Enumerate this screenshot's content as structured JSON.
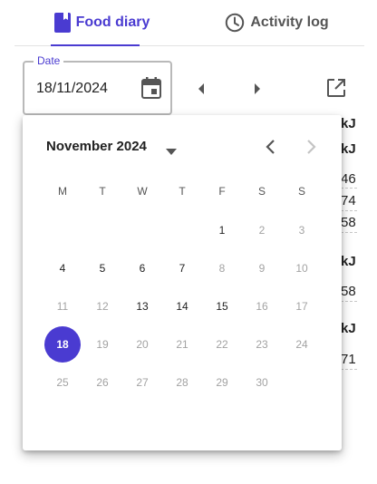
{
  "tabs": {
    "food_diary": "Food diary",
    "activity_log": "Activity log"
  },
  "date_field": {
    "label": "Date",
    "value": "18/11/2024"
  },
  "background_peek": [
    "kJ",
    "kJ",
    "46",
    "74",
    "58",
    "kJ",
    "58",
    "kJ",
    "71"
  ],
  "calendar": {
    "month_label": "November 2024",
    "weekdays": [
      "M",
      "T",
      "W",
      "T",
      "F",
      "S",
      "S"
    ],
    "weeks": [
      [
        null,
        null,
        null,
        null,
        "1",
        "2",
        "3"
      ],
      [
        "4",
        "5",
        "6",
        "7",
        "8",
        "9",
        "10"
      ],
      [
        "11",
        "12",
        "13",
        "14",
        "15",
        "16",
        "17"
      ],
      [
        "18",
        "19",
        "20",
        "21",
        "22",
        "23",
        "24"
      ],
      [
        "25",
        "26",
        "27",
        "28",
        "29",
        "30",
        null
      ]
    ],
    "enabled_days": [
      "1",
      "4",
      "5",
      "6",
      "7",
      "13",
      "14",
      "15"
    ],
    "selected_day": "18"
  },
  "colors": {
    "accent": "#4a3bd1",
    "disabled_text": "#a3a3a3"
  },
  "icons": {
    "food_tab": "book-icon",
    "activity_tab": "clock-icon",
    "date_picker": "calendar-icon",
    "external": "open-in-new-icon"
  }
}
